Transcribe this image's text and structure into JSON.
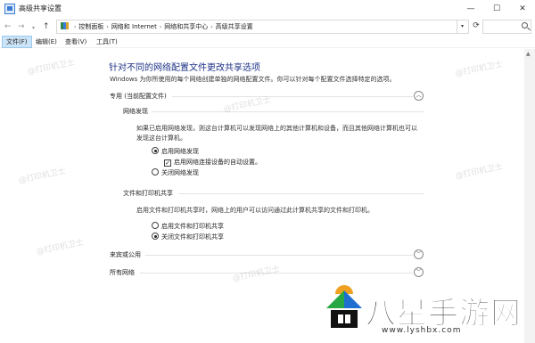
{
  "window": {
    "title": "高级共享设置",
    "min_glyph": "—",
    "max_glyph": "☐",
    "close_glyph": "✕"
  },
  "nav": {
    "back_glyph": "←",
    "forward_glyph": "→",
    "history_glyph": "▾",
    "up_glyph": "↑",
    "breadcrumbs": [
      "控制面板",
      "网络和 Internet",
      "网络和共享中心",
      "高级共享设置"
    ],
    "breadcrumb_sep": "›",
    "dropdown_glyph": "▾",
    "refresh_glyph": "⟳",
    "search_placeholder": ""
  },
  "menu": [
    "文件(F)",
    "编辑(E)",
    "查看(V)",
    "工具(T)"
  ],
  "main": {
    "title": "针对不同的网络配置文件更改共享选项",
    "intro": "Windows 为你所使用的每个网络创建单独的网络配置文件。你可以针对每个配置文件选择特定的选项。",
    "private_profile": {
      "label": "专用 (当前配置文件)",
      "toggle_glyph": "︿",
      "network_discovery": {
        "label": "网络发现",
        "desc": "如果已启用网络发现，则这台计算机可以发现网络上的其他计算机和设备，而且其他网络计算机也可以发现这台计算机。",
        "opt_on": "启用网络发现",
        "opt_auto": "启用网络连接设备的自动设置。",
        "opt_off": "关闭网络发现",
        "selected": "on",
        "auto_checked": true
      },
      "file_sharing": {
        "label": "文件和打印机共享",
        "desc": "启用文件和打印机共享时，网络上的用户可以访问通过此计算机共享的文件和打印机。",
        "opt_on": "启用文件和打印机共享",
        "opt_off": "关闭文件和打印机共享",
        "selected": "off"
      }
    },
    "guest_profile": {
      "label": "来宾或公用",
      "toggle_glyph": "﹀"
    },
    "all_networks": {
      "label": "所有网络",
      "toggle_glyph": "﹀"
    }
  },
  "watermark": "@打印机卫士",
  "brand": {
    "name": "八星手游网",
    "url": "www.lyshbx.com"
  },
  "colors": {
    "title_blue": "#1e3287",
    "menu_highlight": "#cce4f7",
    "logo_green": "#27a844",
    "logo_blue": "#1f6fd1",
    "logo_orange": "#f0a020"
  }
}
